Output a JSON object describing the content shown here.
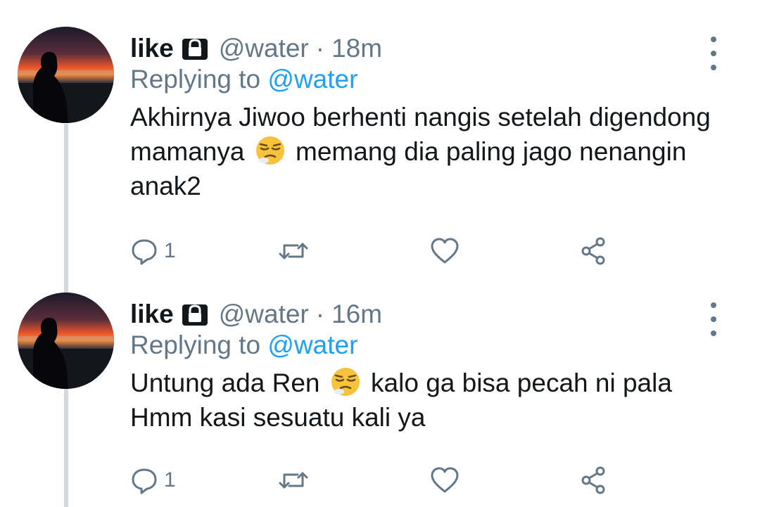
{
  "tweets": [
    {
      "display_name": "like",
      "handle": "@water",
      "separator": "·",
      "time": "18m",
      "replying_prefix": "Replying to",
      "replying_handle": "@water",
      "text_part1": "Akhirnya Jiwoo berhenti nangis setelah digendong mamanya",
      "emoji": "tired-face-emoji",
      "text_part2": "memang dia paling jago nenangin anak2",
      "reply_count": "1"
    },
    {
      "display_name": "like",
      "handle": "@water",
      "separator": "·",
      "time": "16m",
      "replying_prefix": "Replying to",
      "replying_handle": "@water",
      "text_part1": "Untung ada Ren",
      "emoji": "tired-face-emoji",
      "text_part2": "kalo ga bisa pecah ni pala Hmm kasi sesuatu kali ya",
      "reply_count": "1"
    }
  ],
  "colors": {
    "accent": "#1da1f2",
    "secondary_text": "#657786",
    "primary_text": "#14171a",
    "thread_line": "#d3d9de"
  },
  "icons": {
    "lock": "lock-icon",
    "more": "more-vertical-icon",
    "reply": "reply-icon",
    "retweet": "retweet-icon",
    "like": "heart-icon",
    "share": "share-icon"
  }
}
